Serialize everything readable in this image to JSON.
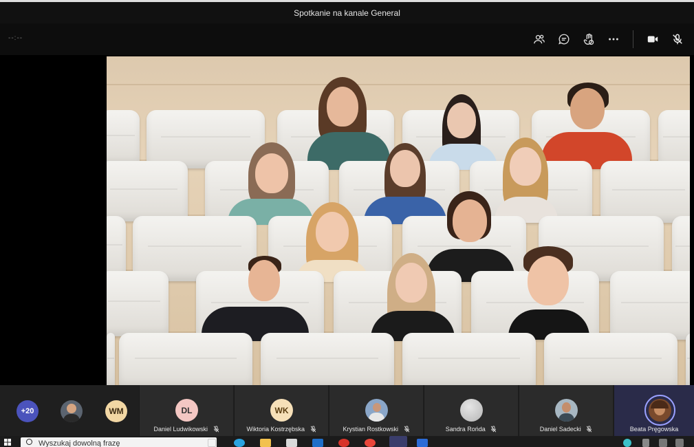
{
  "window": {
    "title": "Spotkanie na kanale General"
  },
  "meeting": {
    "timer": "--:--",
    "toolbar": [
      {
        "name": "participants-icon"
      },
      {
        "name": "chat-icon"
      },
      {
        "name": "reactions-icon"
      },
      {
        "name": "more-actions-icon"
      },
      {
        "name": "camera-icon"
      },
      {
        "name": "mic-muted-icon"
      }
    ]
  },
  "strip": {
    "overflow_count": "+20",
    "mini_avatars": [
      {
        "initials": "",
        "kind": "photo"
      },
      {
        "initials": "WM",
        "color": "#f2d7a4"
      }
    ],
    "tiles": [
      {
        "initials": "DL",
        "name": "Daniel Ludwikowski",
        "muted": true,
        "color": "#f4c7c3"
      },
      {
        "initials": "WK",
        "name": "Wiktoria Kostrzębska",
        "muted": true,
        "color": "#f6e0b8"
      },
      {
        "initials": "",
        "name": "Krystian Rostkowski",
        "muted": true,
        "color": "#8aa6c8"
      },
      {
        "initials": "",
        "name": "Sandra Rońda",
        "muted": true,
        "color": "#cfcfcf"
      },
      {
        "initials": "",
        "name": "Daniel Sadecki",
        "muted": true,
        "color": "#a7b7c2"
      },
      {
        "initials": "",
        "name": "Beata Pręgowska",
        "muted": false,
        "color": "#7a4a2c",
        "selected": true
      }
    ]
  },
  "taskbar": {
    "search_placeholder": "Wyszukaj dowolną frazę"
  }
}
